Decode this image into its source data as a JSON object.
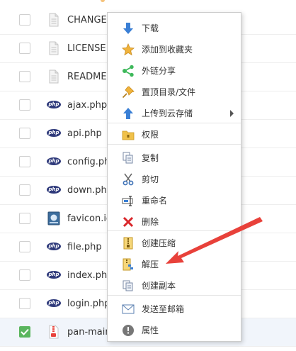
{
  "files": [
    {
      "name": "CHANGEL",
      "icon": "document-icon",
      "selected": false
    },
    {
      "name": "LICENSE",
      "icon": "document-icon",
      "selected": false
    },
    {
      "name": "README.r",
      "icon": "document-icon",
      "selected": false
    },
    {
      "name": "ajax.php",
      "icon": "php-file-icon",
      "selected": false
    },
    {
      "name": "api.php",
      "icon": "php-file-icon",
      "selected": false
    },
    {
      "name": "config.php",
      "icon": "php-file-icon",
      "selected": false
    },
    {
      "name": "down.php",
      "icon": "php-file-icon",
      "selected": false
    },
    {
      "name": "favicon.ico",
      "icon": "image-file-icon",
      "selected": false
    },
    {
      "name": "file.php",
      "icon": "php-file-icon",
      "selected": false
    },
    {
      "name": "index.php",
      "icon": "php-file-icon",
      "selected": false
    },
    {
      "name": "login.php",
      "icon": "php-file-icon",
      "selected": false
    },
    {
      "name": "pan-main.",
      "icon": "zip-file-icon",
      "selected": true
    }
  ],
  "php_badge_text": "php",
  "context_menu": {
    "items": [
      {
        "label": "下载",
        "icon": "download-icon",
        "key": "download"
      },
      {
        "label": "添加到收藏夹",
        "icon": "star-icon",
        "key": "favorite"
      },
      {
        "label": "外链分享",
        "icon": "share-icon",
        "key": "share"
      },
      {
        "label": "置顶目录/文件",
        "icon": "pin-icon",
        "key": "pin"
      },
      {
        "label": "上传到云存储",
        "icon": "upload-icon",
        "key": "upload",
        "has_submenu": true
      },
      {
        "label": "权限",
        "icon": "folder-lock-icon",
        "key": "permission"
      },
      {
        "label": "复制",
        "icon": "copy-icon",
        "key": "copy"
      },
      {
        "label": "剪切",
        "icon": "scissors-icon",
        "key": "cut"
      },
      {
        "label": "重命名",
        "icon": "rename-icon",
        "key": "rename"
      },
      {
        "label": "删除",
        "icon": "delete-icon",
        "key": "delete"
      },
      {
        "label": "创建压缩",
        "icon": "compress-icon",
        "key": "compress"
      },
      {
        "label": "解压",
        "icon": "extract-icon",
        "key": "extract"
      },
      {
        "label": "创建副本",
        "icon": "duplicate-icon",
        "key": "duplicate"
      },
      {
        "label": "发送至邮箱",
        "icon": "mail-icon",
        "key": "email"
      },
      {
        "label": "属性",
        "icon": "info-icon",
        "key": "properties"
      }
    ]
  },
  "colors": {
    "annotation_arrow": "#e8413a",
    "checkbox_checked": "#5ab55e",
    "php_badge": "#2f3a7b",
    "selected_row": "#f1f5fb"
  }
}
